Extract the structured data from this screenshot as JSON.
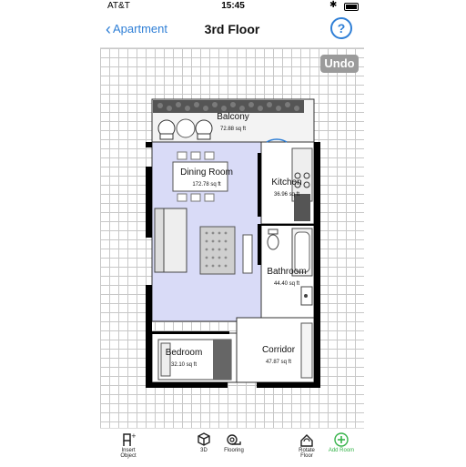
{
  "status": {
    "carrier": "AT&T",
    "time": "15:45"
  },
  "nav": {
    "back_label": "Apartment",
    "title": "3rd Floor",
    "help_label": "?"
  },
  "actions": {
    "undo_label": "Undo"
  },
  "rooms": {
    "balcony": {
      "name": "Balcony",
      "area": "72.88 sq ft"
    },
    "dining": {
      "name": "Dining Room",
      "area": "172.78 sq ft"
    },
    "kitchen": {
      "name": "Kitchen",
      "area": "36.96 sq ft"
    },
    "bathroom": {
      "name": "Bathroom",
      "area": "44.40 sq ft"
    },
    "bedroom": {
      "name": "Bedroom",
      "area": "32.10 sq ft"
    },
    "corridor": {
      "name": "Corridor",
      "area": "47.87 sq ft"
    }
  },
  "toolbar": {
    "insert_object": "Insert\nObject",
    "view_3d": "3D",
    "flooring": "Flooring",
    "rotate_floor": "Rotate\nFloor",
    "add_room": "Add Room"
  },
  "colors": {
    "accent": "#2f7fd6",
    "room_fill": "#d9dbf7",
    "add": "#36b34a"
  }
}
